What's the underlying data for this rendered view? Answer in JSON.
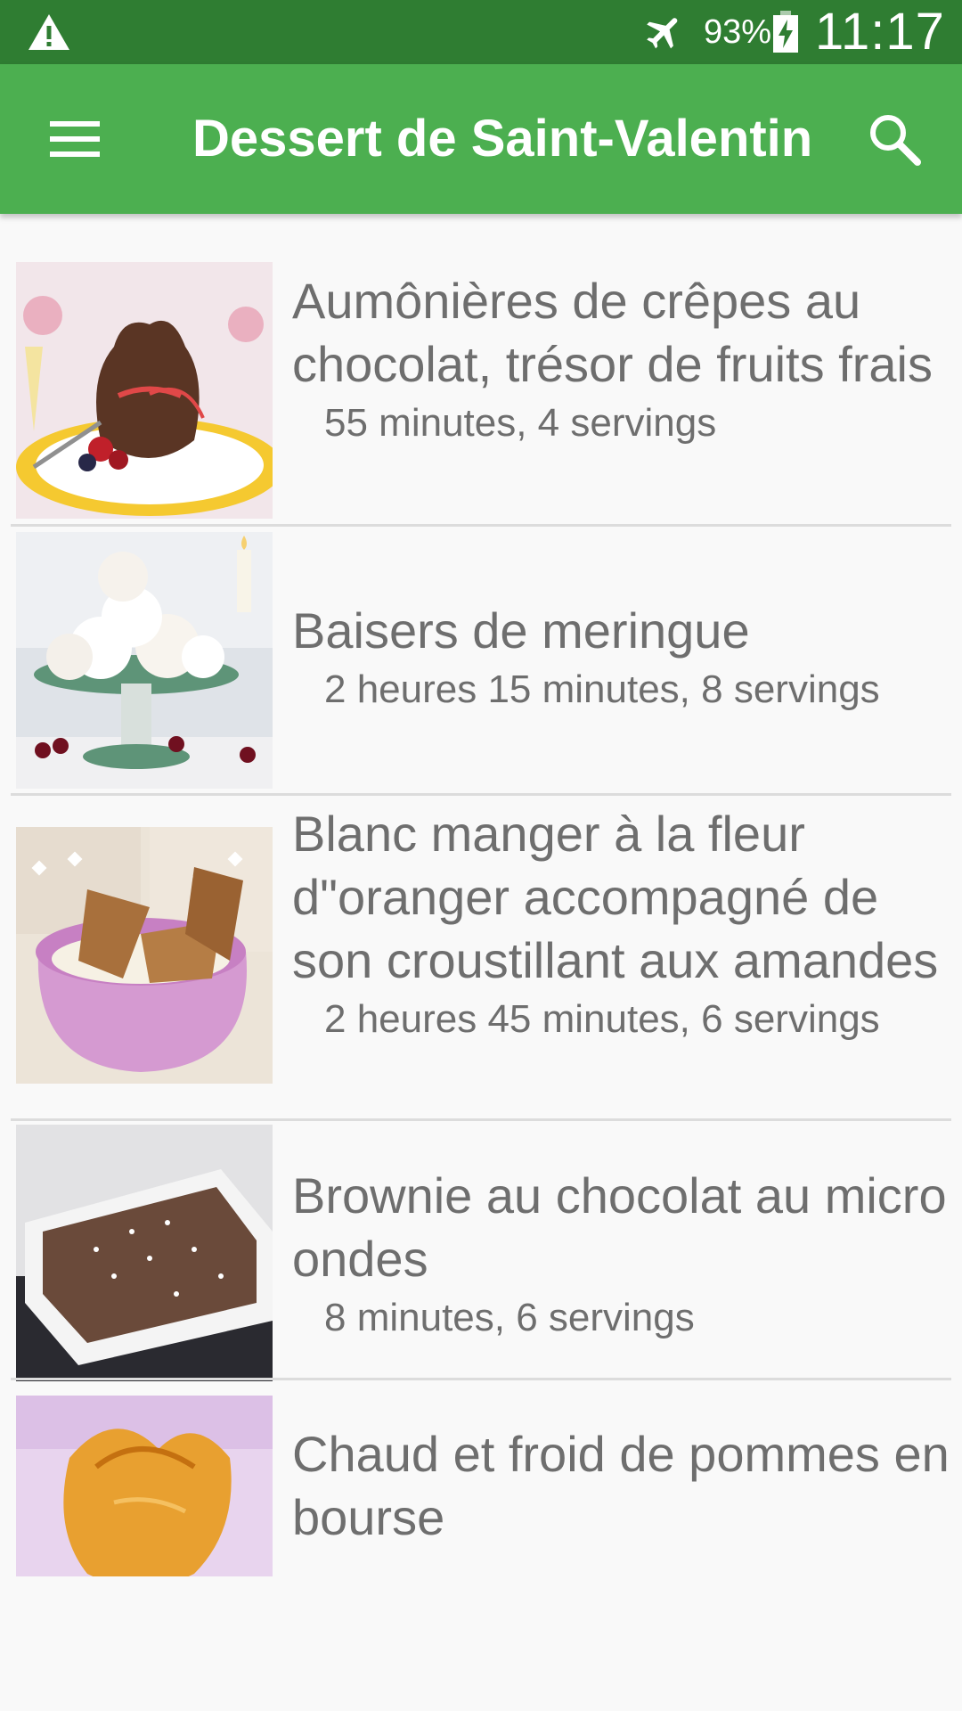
{
  "status_bar": {
    "warning_icon": "warning-icon",
    "airplane_icon": "airplane-mode-icon",
    "battery_percent": "93%",
    "battery_icon": "battery-charging-icon",
    "time": "11:17"
  },
  "app_bar": {
    "title": "Dessert de Saint-Valentin",
    "menu_icon": "hamburger-menu-icon",
    "search_icon": "search-icon",
    "color": "#4caf50",
    "status_color": "#2f7d32"
  },
  "recipes": [
    {
      "title": "Aumônières de crêpes au chocolat, trésor de fruits frais",
      "meta": "55 minutes, 4 servings"
    },
    {
      "title": "Baisers de meringue",
      "meta": "2 heures 15 minutes, 8 servings"
    },
    {
      "title": "Blanc manger à la fleur d\"oranger accompagné de son croustillant aux amandes",
      "meta": "2 heures 45 minutes, 6 servings"
    },
    {
      "title": "Brownie au chocolat au micro ondes",
      "meta": "8 minutes, 6 servings"
    },
    {
      "title": "Chaud et froid de pommes en bourse",
      "meta": ""
    }
  ]
}
